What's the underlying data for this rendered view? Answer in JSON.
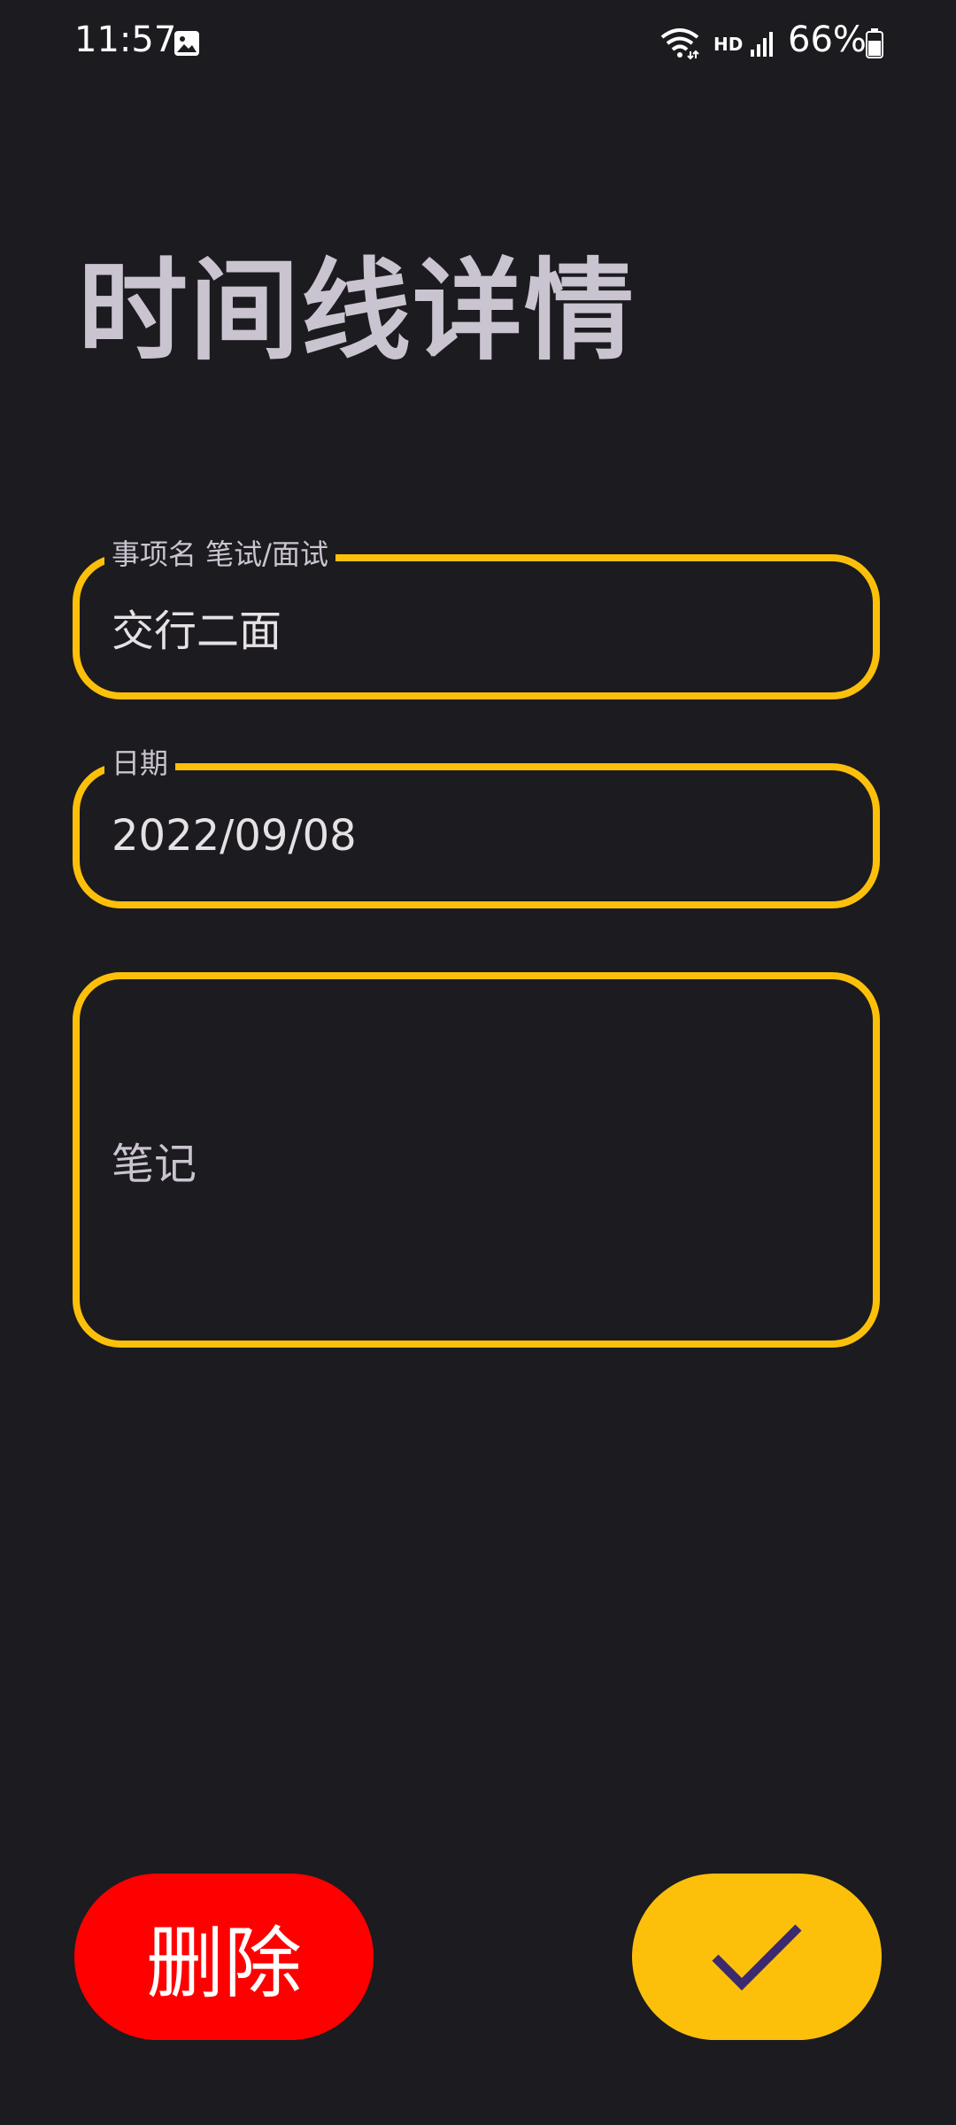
{
  "status_bar": {
    "time": "11:57",
    "network_label": "HD",
    "battery_percent": "66%",
    "icons": [
      "gallery-icon",
      "wifi-icon",
      "signal-icon",
      "battery-icon"
    ]
  },
  "page": {
    "title": "时间线详情"
  },
  "form": {
    "name_field": {
      "label": "事项名 笔试/面试",
      "value": "交行二面"
    },
    "date_field": {
      "label": "日期",
      "value": "2022/09/08"
    },
    "notes_field": {
      "placeholder": "笔记"
    }
  },
  "actions": {
    "delete_label": "删除",
    "confirm_icon": "check-icon"
  },
  "colors": {
    "background": "#1c1b1f",
    "accent": "#fcc00b",
    "delete": "#ff0000",
    "check": "#3d2a6e"
  }
}
